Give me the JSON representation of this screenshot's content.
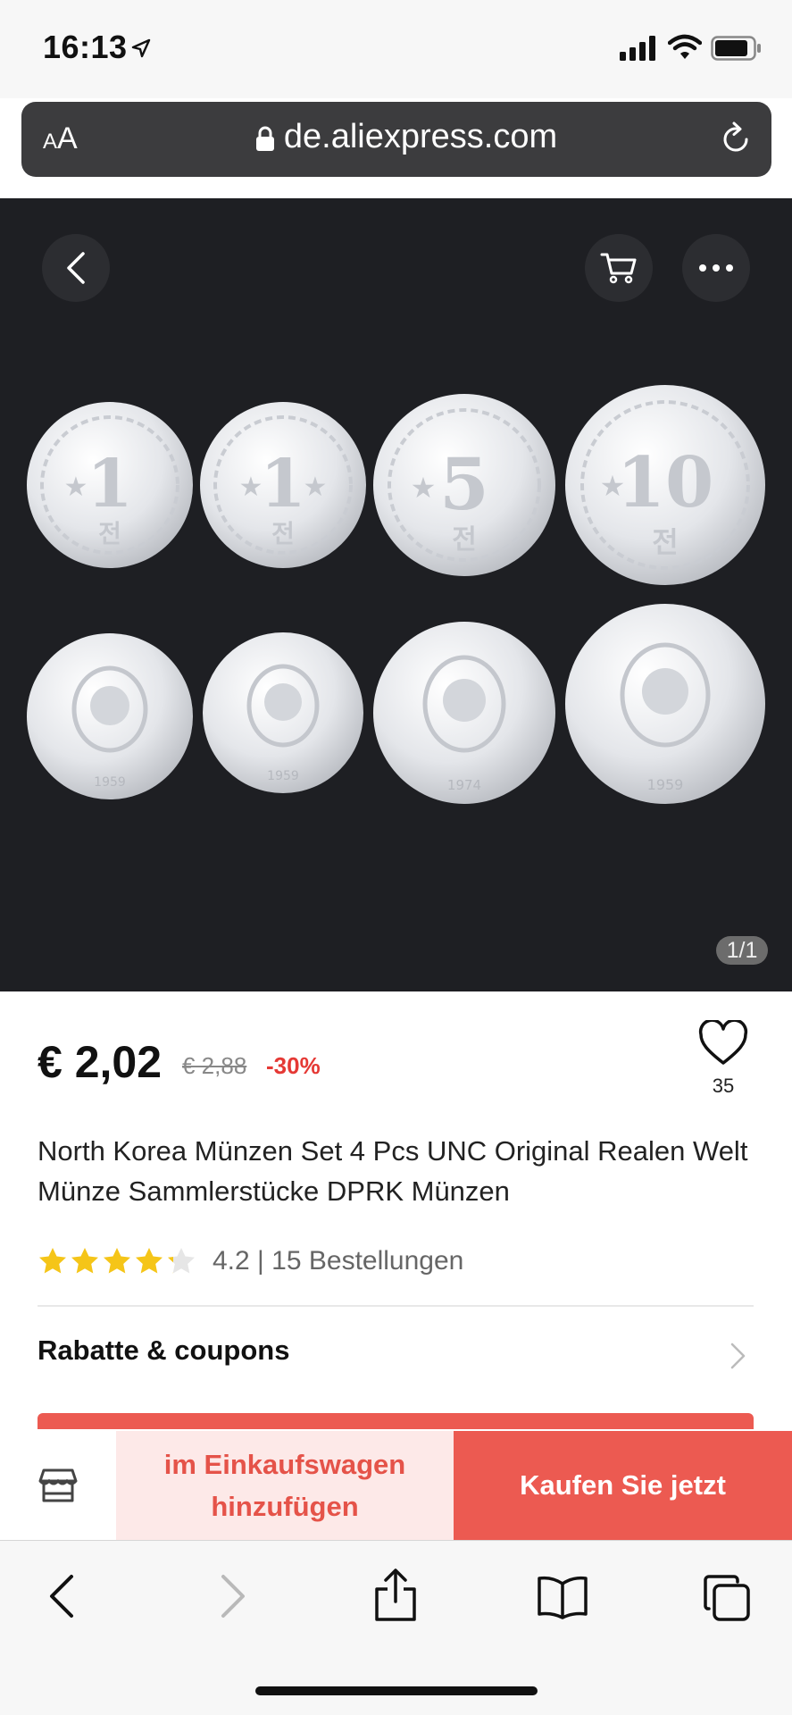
{
  "status": {
    "time": "16:13"
  },
  "browser": {
    "aa_small": "A",
    "aa_large": "A",
    "url": "de.aliexpress.com"
  },
  "gallery": {
    "counter": "1/1"
  },
  "product": {
    "price": "€ 2,02",
    "original_price": "€ 2,88",
    "discount": "-30%",
    "wishlist_count": "35",
    "title": "North Korea Münzen Set 4 Pcs UNC Original Realen Welt Münze Sammlerstücke DPRK Münzen",
    "rating_value": 4.2,
    "rating_text": "4.2 | 15 Bestellungen",
    "coupons_label": "Rabatte & coupons"
  },
  "coins": {
    "obverse": [
      {
        "denomination": "1",
        "unit": "전"
      },
      {
        "denomination": "1",
        "unit": "전"
      },
      {
        "denomination": "5",
        "unit": "전"
      },
      {
        "denomination": "10",
        "unit": "전"
      }
    ],
    "reverse_years": [
      "1959",
      "1959",
      "1974",
      "1959"
    ]
  },
  "actions": {
    "add_to_cart": "im Einkaufswagen hinzufügen",
    "buy_now": "Kaufen Sie jetzt"
  },
  "colors": {
    "accent": "#ec5a51",
    "discount": "#e53935",
    "star": "#f5c518",
    "dark_bg": "#1e1f23"
  }
}
